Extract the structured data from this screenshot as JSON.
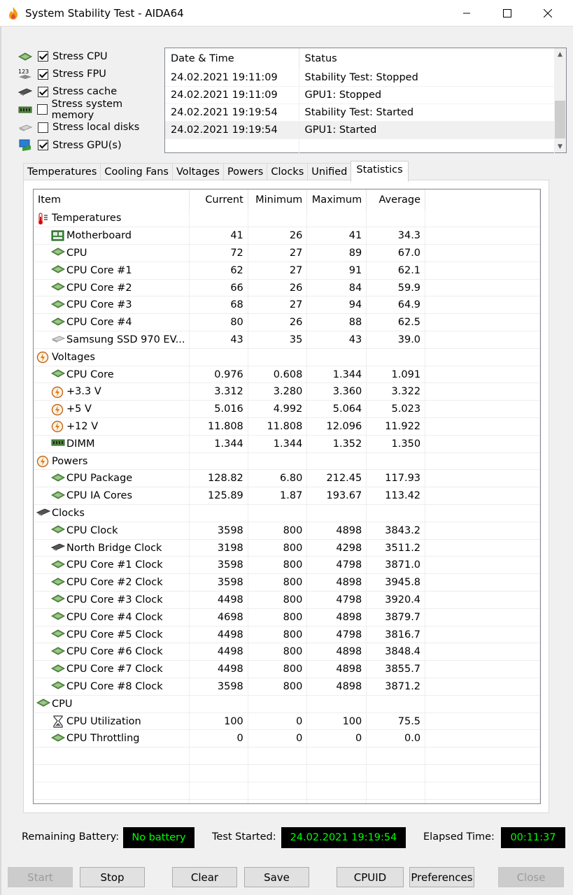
{
  "window": {
    "title": "System Stability Test - AIDA64"
  },
  "stress": [
    {
      "label": "Stress CPU",
      "checked": true,
      "icon": "cpu-icon"
    },
    {
      "label": "Stress FPU",
      "checked": true,
      "icon": "fpu-123-icon"
    },
    {
      "label": "Stress cache",
      "checked": true,
      "icon": "cache-chip-icon"
    },
    {
      "label": "Stress system memory",
      "checked": false,
      "icon": "memory-module-icon"
    },
    {
      "label": "Stress local disks",
      "checked": false,
      "icon": "disk-icon"
    },
    {
      "label": "Stress GPU(s)",
      "checked": true,
      "icon": "gpu-monitor-icon"
    }
  ],
  "log": {
    "headers": [
      "Date & Time",
      "Status"
    ],
    "rows": [
      [
        "24.02.2021 19:11:09",
        "Stability Test: Stopped"
      ],
      [
        "24.02.2021 19:11:09",
        "GPU1: Stopped"
      ],
      [
        "24.02.2021 19:19:54",
        "Stability Test: Started"
      ],
      [
        "24.02.2021 19:19:54",
        "GPU1: Started"
      ]
    ]
  },
  "tabs": [
    "Temperatures",
    "Cooling Fans",
    "Voltages",
    "Powers",
    "Clocks",
    "Unified",
    "Statistics"
  ],
  "active_tab": "Statistics",
  "stats": {
    "headers": [
      "Item",
      "Current",
      "Minimum",
      "Maximum",
      "Average"
    ],
    "rows": [
      {
        "group": true,
        "icon": "thermometer-icon",
        "item": "Temperatures"
      },
      {
        "icon": "motherboard-icon",
        "item": "Motherboard",
        "cur": "41",
        "min": "26",
        "max": "41",
        "avg": "34.3"
      },
      {
        "icon": "cpu-icon",
        "item": "CPU",
        "cur": "72",
        "min": "27",
        "max": "89",
        "avg": "67.0"
      },
      {
        "icon": "cpu-icon",
        "item": "CPU Core #1",
        "cur": "62",
        "min": "27",
        "max": "91",
        "avg": "62.1"
      },
      {
        "icon": "cpu-icon",
        "item": "CPU Core #2",
        "cur": "66",
        "min": "26",
        "max": "84",
        "avg": "59.9"
      },
      {
        "icon": "cpu-icon",
        "item": "CPU Core #3",
        "cur": "68",
        "min": "27",
        "max": "94",
        "avg": "64.9"
      },
      {
        "icon": "cpu-icon",
        "item": "CPU Core #4",
        "cur": "80",
        "min": "26",
        "max": "88",
        "avg": "62.5"
      },
      {
        "icon": "disk-icon",
        "item": "Samsung SSD 970 EV...",
        "cur": "43",
        "min": "35",
        "max": "43",
        "avg": "39.0"
      },
      {
        "group": true,
        "icon": "voltage-icon",
        "item": "Voltages"
      },
      {
        "icon": "cpu-icon",
        "item": "CPU Core",
        "cur": "0.976",
        "min": "0.608",
        "max": "1.344",
        "avg": "1.091"
      },
      {
        "icon": "voltage-icon",
        "item": "+3.3 V",
        "cur": "3.312",
        "min": "3.280",
        "max": "3.360",
        "avg": "3.322"
      },
      {
        "icon": "voltage-icon",
        "item": "+5 V",
        "cur": "5.016",
        "min": "4.992",
        "max": "5.064",
        "avg": "5.023"
      },
      {
        "icon": "voltage-icon",
        "item": "+12 V",
        "cur": "11.808",
        "min": "11.808",
        "max": "12.096",
        "avg": "11.922"
      },
      {
        "icon": "memory-module-icon",
        "item": "DIMM",
        "cur": "1.344",
        "min": "1.344",
        "max": "1.352",
        "avg": "1.350"
      },
      {
        "group": true,
        "icon": "voltage-icon",
        "item": "Powers"
      },
      {
        "icon": "cpu-icon",
        "item": "CPU Package",
        "cur": "128.82",
        "min": "6.80",
        "max": "212.45",
        "avg": "117.93"
      },
      {
        "icon": "cpu-icon",
        "item": "CPU IA Cores",
        "cur": "125.89",
        "min": "1.87",
        "max": "193.67",
        "avg": "113.42"
      },
      {
        "group": true,
        "icon": "cache-chip-icon",
        "item": "Clocks"
      },
      {
        "icon": "cpu-icon",
        "item": "CPU Clock",
        "cur": "3598",
        "min": "800",
        "max": "4898",
        "avg": "3843.2"
      },
      {
        "icon": "cache-chip-icon",
        "item": "North Bridge Clock",
        "cur": "3198",
        "min": "800",
        "max": "4298",
        "avg": "3511.2"
      },
      {
        "icon": "cpu-icon",
        "item": "CPU Core #1 Clock",
        "cur": "3598",
        "min": "800",
        "max": "4798",
        "avg": "3871.0"
      },
      {
        "icon": "cpu-icon",
        "item": "CPU Core #2 Clock",
        "cur": "3598",
        "min": "800",
        "max": "4898",
        "avg": "3945.8"
      },
      {
        "icon": "cpu-icon",
        "item": "CPU Core #3 Clock",
        "cur": "4498",
        "min": "800",
        "max": "4798",
        "avg": "3920.4"
      },
      {
        "icon": "cpu-icon",
        "item": "CPU Core #4 Clock",
        "cur": "4698",
        "min": "800",
        "max": "4898",
        "avg": "3879.7"
      },
      {
        "icon": "cpu-icon",
        "item": "CPU Core #5 Clock",
        "cur": "4498",
        "min": "800",
        "max": "4798",
        "avg": "3816.7"
      },
      {
        "icon": "cpu-icon",
        "item": "CPU Core #6 Clock",
        "cur": "4498",
        "min": "800",
        "max": "4898",
        "avg": "3848.4"
      },
      {
        "icon": "cpu-icon",
        "item": "CPU Core #7 Clock",
        "cur": "4498",
        "min": "800",
        "max": "4898",
        "avg": "3855.7"
      },
      {
        "icon": "cpu-icon",
        "item": "CPU Core #8 Clock",
        "cur": "3598",
        "min": "800",
        "max": "4898",
        "avg": "3871.2"
      },
      {
        "group": true,
        "icon": "cpu-icon",
        "item": "CPU"
      },
      {
        "icon": "hourglass-icon",
        "item": "CPU Utilization",
        "cur": "100",
        "min": "0",
        "max": "100",
        "avg": "75.5"
      },
      {
        "icon": "cpu-icon",
        "item": "CPU Throttling",
        "cur": "0",
        "min": "0",
        "max": "0",
        "avg": "0.0"
      }
    ]
  },
  "status": {
    "battery_label": "Remaining Battery:",
    "battery_value": "No battery",
    "started_label": "Test Started:",
    "started_value": "24.02.2021 19:19:54",
    "elapsed_label": "Elapsed Time:",
    "elapsed_value": "00:11:37"
  },
  "buttons": {
    "start": "Start",
    "stop": "Stop",
    "clear": "Clear",
    "save": "Save",
    "cpuid": "CPUID",
    "preferences": "Preferences",
    "close": "Close"
  },
  "colors": {
    "status_bg": "#000000",
    "status_fg": "#00ff00",
    "tab_active_bg": "#ffffff"
  }
}
